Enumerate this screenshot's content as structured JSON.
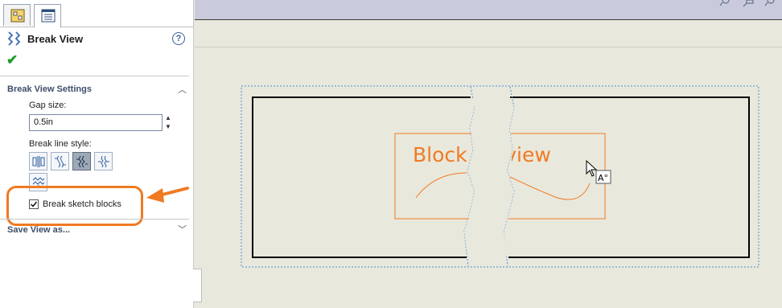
{
  "property_manager": {
    "tabs": [
      {
        "icon": "feature-manager-icon",
        "active": false
      },
      {
        "icon": "property-manager-icon",
        "active": true
      }
    ],
    "title": "Break View",
    "help_symbol": "?",
    "ok_symbol": "✔",
    "groups": {
      "settings": {
        "title": "Break View Settings",
        "gap_label": "Gap size:",
        "gap_value": "0.5in",
        "style_label": "Break line style:",
        "styles": [
          "straight-cut",
          "curve-cut",
          "zig-zag-cut",
          "small-zig-zag-cut",
          "jagged-cut"
        ],
        "selected_style": "zig-zag-cut",
        "checkbox_label": "Break sketch blocks",
        "checkbox_checked": true
      },
      "save_view": {
        "title": "Save View as..."
      }
    }
  },
  "canvas": {
    "block_text": "Blocking view",
    "cursor_badge": "A°",
    "colors": {
      "block": "#f07a22",
      "view_border": "#000000",
      "selection": "#4a90d9",
      "callout": "#f07a22"
    }
  }
}
